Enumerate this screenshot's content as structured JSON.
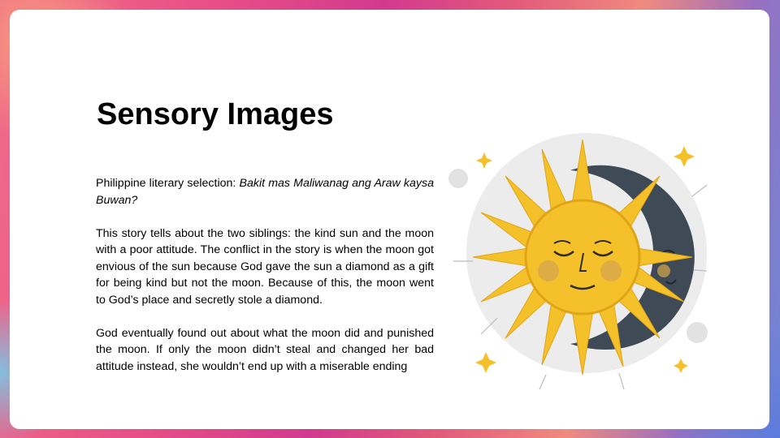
{
  "slide": {
    "title": "Sensory Images",
    "intro_label": "Philippine literary selection:",
    "intro_title": "Bakit mas Maliwanag ang Araw kaysa Buwan?",
    "paragraph_1": "This story tells about the two siblings: the kind sun and the moon with a poor attitude. The conflict in the story is when the moon got envious of the sun because God gave the sun a diamond as a gift for being kind but not the moon. Because of this, the moon went to God’s place and secretly stole a diamond.",
    "paragraph_2": "God eventually found out about what the moon did and punished the moon. If only the moon didn’t steal and changed her bad attitude instead, she wouldn’t end up with a miserable ending"
  },
  "illustration": {
    "icon": "sun-and-moon-icon",
    "colors": {
      "sun": "#f5c12a",
      "sun_dark": "#e0a516",
      "moon": "#3e4a56",
      "cheek": "#d9a84a",
      "halo": "#ececec"
    }
  }
}
